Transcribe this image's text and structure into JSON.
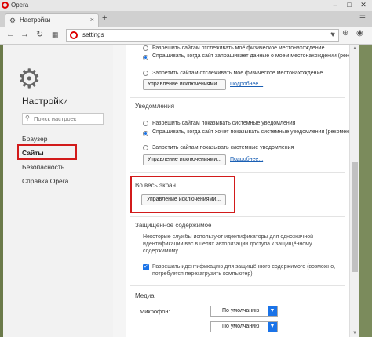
{
  "window": {
    "app_title": "Opera",
    "controls": [
      "–",
      "□",
      "✕"
    ]
  },
  "tab": {
    "label": "Настройки",
    "new_tab": "+"
  },
  "address": {
    "url": "settings"
  },
  "sidebar": {
    "title": "Настройки",
    "search_placeholder": "Поиск настроек",
    "items": [
      {
        "label": "Браузер"
      },
      {
        "label": "Сайты"
      },
      {
        "label": "Безопасность"
      },
      {
        "label": "Справка Opera"
      }
    ]
  },
  "location": {
    "options": [
      "Разрешить сайтам отслеживать моё физическое местонахождение",
      "Спрашивать, когда сайт запрашивает данные о моем местонахождении (рекомендуется)",
      "Запретить сайтам отслеживать моё физическое местонахождение"
    ],
    "selected": 1,
    "manage_button": "Управление исключениями...",
    "more_link": "Подробнее..."
  },
  "notifications": {
    "title": "Уведомления",
    "options": [
      "Разрешить сайтам показывать системные уведомления",
      "Спрашивать, когда сайт хочет показывать системные уведомления (рекомендуется)",
      "Запретить сайтам показывать системные уведомления"
    ],
    "selected": 1,
    "manage_button": "Управление исключениями...",
    "more_link": "Подробнее..."
  },
  "fullscreen": {
    "title": "Во весь экран",
    "manage_button": "Управление исключениями..."
  },
  "protected": {
    "title": "Защищённое содержимое",
    "description": "Некоторые службы используют идентификаторы для однозначной идентификации вас в целях авторизации доступа к защищённому содержимому.",
    "checkbox_label": "Разрешать идентификацию для защищённого содержимого (возможно, потребуется перезагрузить компьютер)",
    "checked": true
  },
  "media": {
    "title": "Медиа",
    "microphone_label": "Микрофон:",
    "microphone_value": "По умолчанию",
    "camera_value": "По умолчанию"
  },
  "colors": {
    "highlight": "#d21b1b",
    "accent": "#1a73e8"
  }
}
